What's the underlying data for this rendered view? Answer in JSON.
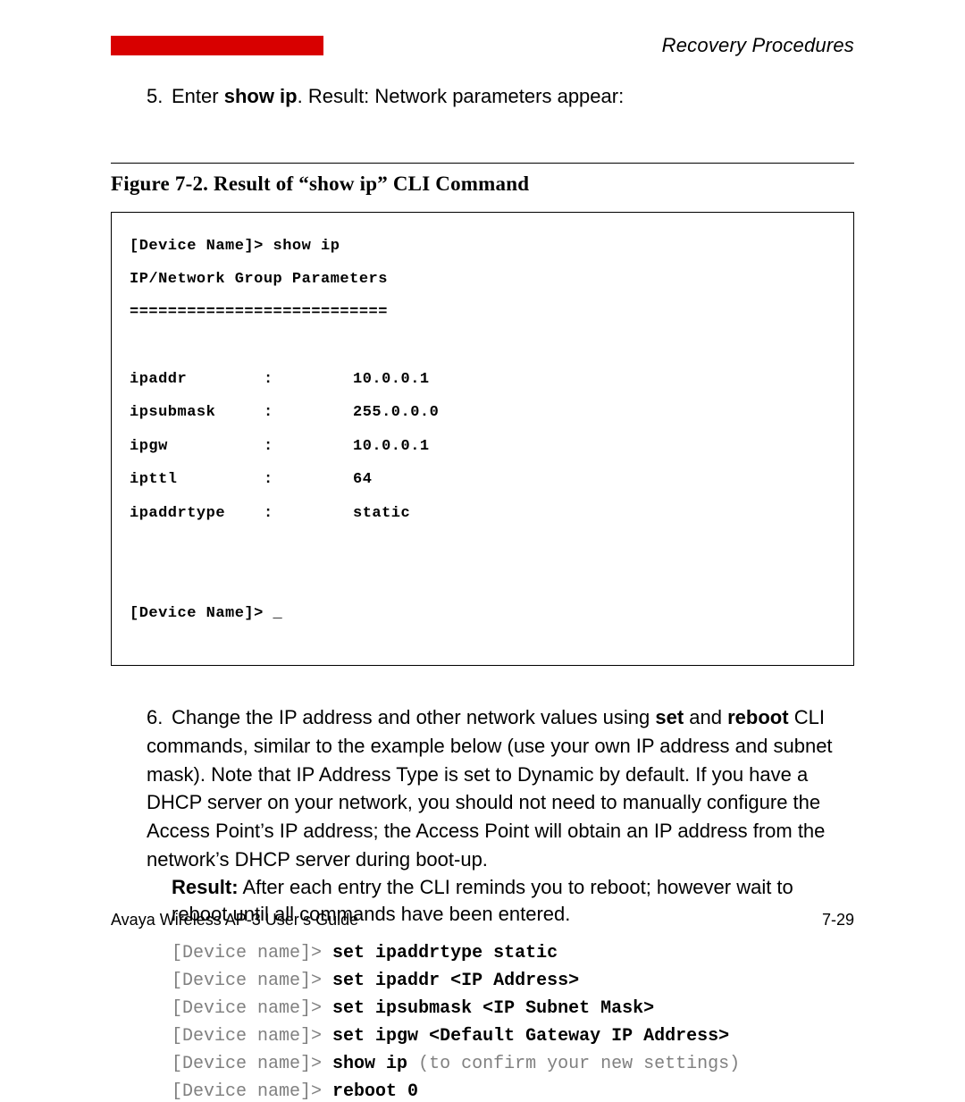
{
  "header": {
    "section_title": "Recovery Procedures"
  },
  "step5": {
    "num": "5.",
    "before": "Enter ",
    "cmd": "show ip",
    "after": ". Result: Network parameters appear:"
  },
  "figure": {
    "caption": "Figure 7-2.    Result of “show ip” CLI Command"
  },
  "cli": {
    "line1": "[Device Name]> show ip",
    "line2": "IP/Network Group Parameters",
    "sep": "===========================",
    "rows": [
      {
        "k": "ipaddr",
        "v": "10.0.0.1"
      },
      {
        "k": "ipsubmask",
        "v": "255.0.0.0"
      },
      {
        "k": "ipgw",
        "v": "10.0.0.1"
      },
      {
        "k": "ipttl",
        "v": "64"
      },
      {
        "k": "ipaddrtype",
        "v": "static"
      }
    ],
    "prompt": "[Device Name]> _"
  },
  "step6": {
    "num": "6.",
    "text_a": "Change the IP address and other network values using ",
    "cmd_a": "set",
    "text_b": " and ",
    "cmd_b": "reboot",
    "text_c": " CLI commands, similar to the example below (use your own IP address and subnet mask). Note that IP Address Type is set to Dynamic by default. If you have a DHCP server on your network, you should not need to manually configure the Access Point’s IP address; the Access Point will obtain an IP address from the network’s DHCP server during boot-up."
  },
  "result": {
    "label": "Result:",
    "text": " After each entry the CLI reminds you to reboot; however wait to reboot until all commands have been entered."
  },
  "cmds": [
    {
      "p": "[Device name]>",
      "c": "set ipaddrtype static",
      "n": ""
    },
    {
      "p": "[Device name]>",
      "c": "set ipaddr <IP Address>",
      "n": ""
    },
    {
      "p": "[Device name]>",
      "c": "set ipsubmask <IP Subnet Mask>",
      "n": ""
    },
    {
      "p": "[Device name]>",
      "c": "set ipgw <Default Gateway IP Address>",
      "n": ""
    },
    {
      "p": "[Device name]>",
      "c": "show ip",
      "n": " (to confirm your new settings)"
    },
    {
      "p": "[Device name]>",
      "c": "reboot 0",
      "n": ""
    }
  ],
  "footer": {
    "left": "Avaya Wireless AP-3 User’s Guide",
    "right": "7-29"
  }
}
